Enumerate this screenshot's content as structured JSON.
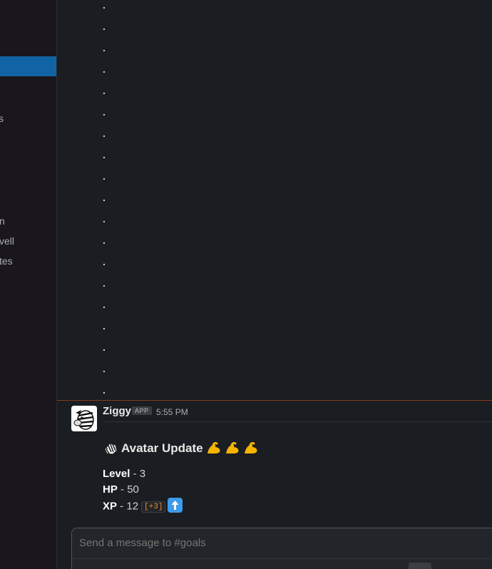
{
  "sidebar": {
    "items": [
      {
        "label": "s"
      },
      {
        "label": "s"
      },
      {
        "label": "n"
      },
      {
        "label": "vell"
      },
      {
        "label": "tes"
      }
    ]
  },
  "feed": {
    "dot_char": "."
  },
  "message": {
    "author": "Ziggy",
    "badge": "APP",
    "time": "5:55 PM",
    "title": "Avatar Update",
    "stats": [
      {
        "label": "Level",
        "sep": " - ",
        "value": "3"
      },
      {
        "label": "HP",
        "sep": " - ",
        "value": "50"
      },
      {
        "label": "XP",
        "sep": " - ",
        "value": "12"
      }
    ],
    "xp_delta": "[+3]"
  },
  "composer": {
    "placeholder": "Send a message to #goals"
  },
  "colors": {
    "active_item": "#1164a3",
    "divider": "#8b3a22",
    "xp_delta": "#e8912d"
  }
}
